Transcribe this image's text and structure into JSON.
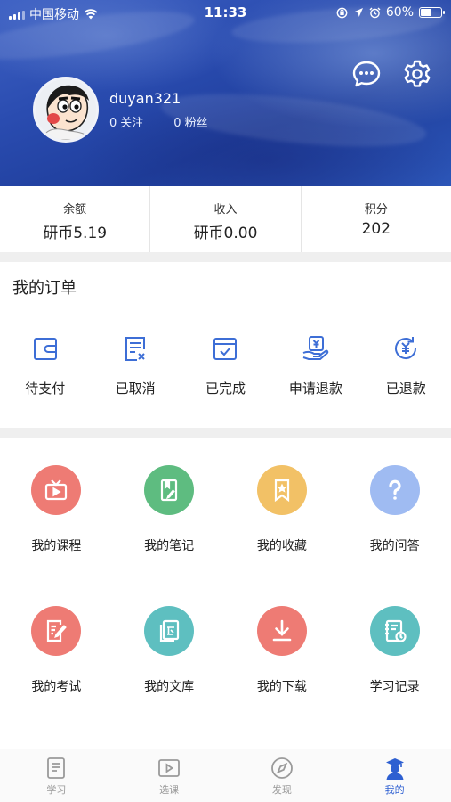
{
  "status_bar": {
    "carrier": "中国移动",
    "time": "11:33",
    "battery": "60%",
    "battery_level": 0.6
  },
  "profile": {
    "username": "duyan321",
    "following_count": "0",
    "following_label": "关注",
    "followers_count": "0",
    "followers_label": "粉丝"
  },
  "stats": [
    {
      "label": "余额",
      "value": "研币5.19"
    },
    {
      "label": "收入",
      "value": "研币0.00"
    },
    {
      "label": "积分",
      "value": "202"
    }
  ],
  "orders": {
    "title": "我的订单",
    "items": [
      {
        "label": "待支付",
        "icon": "wallet-icon"
      },
      {
        "label": "已取消",
        "icon": "cancelled-list-icon"
      },
      {
        "label": "已完成",
        "icon": "calendar-check-icon"
      },
      {
        "label": "申请退款",
        "icon": "refund-request-icon"
      },
      {
        "label": "已退款",
        "icon": "refunded-icon"
      }
    ]
  },
  "functions": [
    {
      "label": "我的课程",
      "icon": "video-icon",
      "color": "#ee7b74"
    },
    {
      "label": "我的笔记",
      "icon": "notebook-icon",
      "color": "#5ebc80"
    },
    {
      "label": "我的收藏",
      "icon": "bookmark-star-icon",
      "color": "#f2c166"
    },
    {
      "label": "我的问答",
      "icon": "question-icon",
      "color": "#9fbbf2"
    },
    {
      "label": "我的考试",
      "icon": "exam-icon",
      "color": "#ee7b74"
    },
    {
      "label": "我的文库",
      "icon": "library-icon",
      "color": "#5ebfc0"
    },
    {
      "label": "我的下载",
      "icon": "download-icon",
      "color": "#ee7b74"
    },
    {
      "label": "学习记录",
      "icon": "study-record-icon",
      "color": "#5ebfc0"
    }
  ],
  "tabs": [
    {
      "label": "学习",
      "icon": "study-tab-icon"
    },
    {
      "label": "选课",
      "icon": "course-select-tab-icon"
    },
    {
      "label": "发现",
      "icon": "discover-tab-icon"
    },
    {
      "label": "我的",
      "icon": "profile-tab-icon"
    }
  ],
  "colors": {
    "accent": "#2d5fd1",
    "order_icon": "#3d6ed6",
    "tab_inactive": "#9a9a9a"
  }
}
